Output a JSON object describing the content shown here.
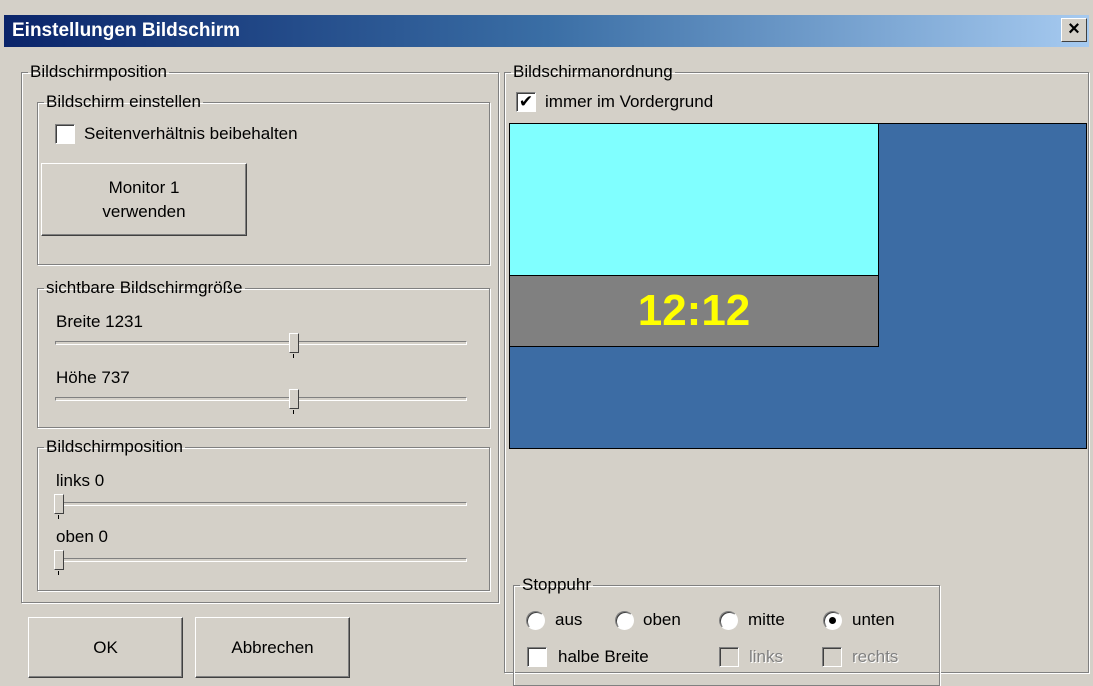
{
  "window": {
    "title": "Einstellungen Bildschirm",
    "close_glyph": "×"
  },
  "left_panel": {
    "legend": "Bildschirmposition",
    "adjust_group": {
      "legend": "Bildschirm einstellen",
      "aspect_label": "Seitenverhältnis beibehalten",
      "aspect_checked": false,
      "monitor_button_line1": "Monitor 1",
      "monitor_button_line2": "verwenden"
    },
    "size_group": {
      "legend": "sichtbare Bildschirmgröße",
      "width_label": "Breite 1231",
      "width_value": 1231,
      "width_fraction": 0.58,
      "height_label": "Höhe 737",
      "height_value": 737,
      "height_fraction": 0.58
    },
    "position_group": {
      "legend": "Bildschirmposition",
      "left_label": "links 0",
      "left_value": 0,
      "top_label": "oben 0",
      "top_value": 0
    }
  },
  "buttons": {
    "ok": "OK",
    "cancel": "Abbrechen"
  },
  "right_panel": {
    "legend": "Bildschirmanordnung",
    "always_on_top_label": "immer im Vordergrund",
    "always_on_top_checked": true,
    "check_glyph": "✔",
    "preview": {
      "background_color": "#3c6ca4",
      "monitor_color": "#80ffff",
      "clock_bar_color": "#808080",
      "clock_text": "12:12",
      "clock_text_color": "#ffff00"
    },
    "stopwatch": {
      "legend": "Stoppuhr",
      "options": [
        "aus",
        "oben",
        "mitte",
        "unten"
      ],
      "selected": "unten",
      "half_width_label": "halbe Breite",
      "left_label": "links",
      "right_label": "rechts"
    }
  }
}
